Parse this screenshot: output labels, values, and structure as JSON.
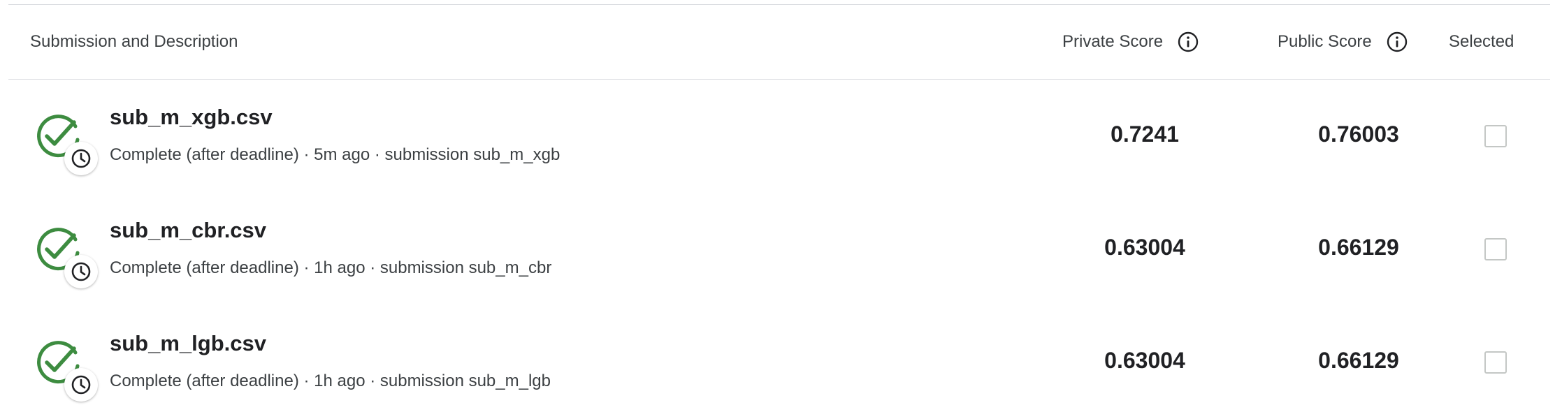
{
  "header": {
    "submission_label": "Submission and Description",
    "private_score_label": "Private Score",
    "public_score_label": "Public Score",
    "selected_label": "Selected"
  },
  "colors": {
    "success_green": "#3d8c40",
    "border": "#dadce0",
    "checkbox_border": "#c4c7c5"
  },
  "rows": [
    {
      "name": "sub_m_xgb.csv",
      "description": "Complete (after deadline) · 5m ago · submission sub_m_xgb",
      "private_score": "0.7241",
      "public_score": "0.76003",
      "selected": false,
      "status_icon": "check-circle-icon",
      "badge_icon": "clock-icon"
    },
    {
      "name": "sub_m_cbr.csv",
      "description": "Complete (after deadline) · 1h ago · submission sub_m_cbr",
      "private_score": "0.63004",
      "public_score": "0.66129",
      "selected": false,
      "status_icon": "check-circle-icon",
      "badge_icon": "clock-icon"
    },
    {
      "name": "sub_m_lgb.csv",
      "description": "Complete (after deadline) · 1h ago · submission sub_m_lgb",
      "private_score": "0.63004",
      "public_score": "0.66129",
      "selected": false,
      "status_icon": "check-circle-icon",
      "badge_icon": "clock-icon"
    }
  ]
}
